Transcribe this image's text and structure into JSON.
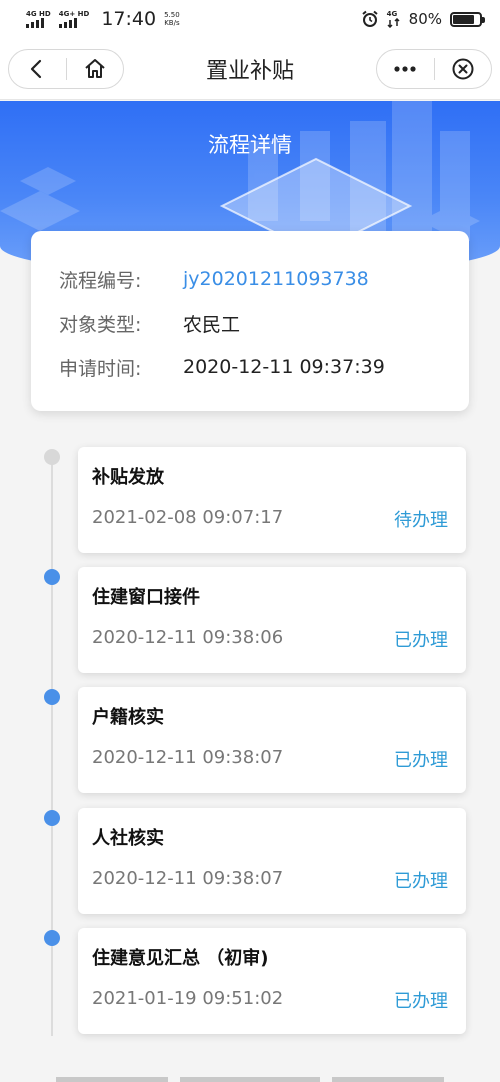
{
  "status_bar": {
    "signal1_label": "4G HD",
    "signal2_label": "4G+ HD",
    "time": "17:40",
    "speed_value": "5.50",
    "speed_unit": "KB/s",
    "network_label": "4G",
    "battery_pct": "80%",
    "battery_level": 0.8
  },
  "nav": {
    "title": "置业补贴",
    "back_icon": "chevron-left-icon",
    "home_icon": "home-icon",
    "more_icon": "more-dots-icon",
    "close_icon": "close-circle-icon"
  },
  "hero": {
    "title": "流程详情",
    "colors": {
      "top": "#2f6ff5",
      "bottom": "#6ea1fa"
    }
  },
  "info": {
    "rows": [
      {
        "label": "流程编号:",
        "value": "jy20201211093738"
      },
      {
        "label": "对象类型:",
        "value": "农民工"
      },
      {
        "label": "申请时间:",
        "value": "2020-12-11 09:37:39"
      }
    ]
  },
  "steps": [
    {
      "name": "补贴发放",
      "time": "2021-02-08 09:07:17",
      "status": "待办理"
    },
    {
      "name": "住建窗口接件",
      "time": "2020-12-11 09:38:06",
      "status": "已办理"
    },
    {
      "name": "户籍核实",
      "time": "2020-12-11 09:38:07",
      "status": "已办理"
    },
    {
      "name": "人社核实",
      "time": "2020-12-11 09:38:07",
      "status": "已办理"
    },
    {
      "name": "住建意见汇总 （初审)",
      "time": "2021-01-19 09:51:02",
      "status": "已办理"
    }
  ],
  "colors": {
    "accent": "#3a8ee6",
    "status_done": "#2f9bd6",
    "dot_active": "#4a90e8",
    "dot_pending": "#d8d8d8"
  }
}
